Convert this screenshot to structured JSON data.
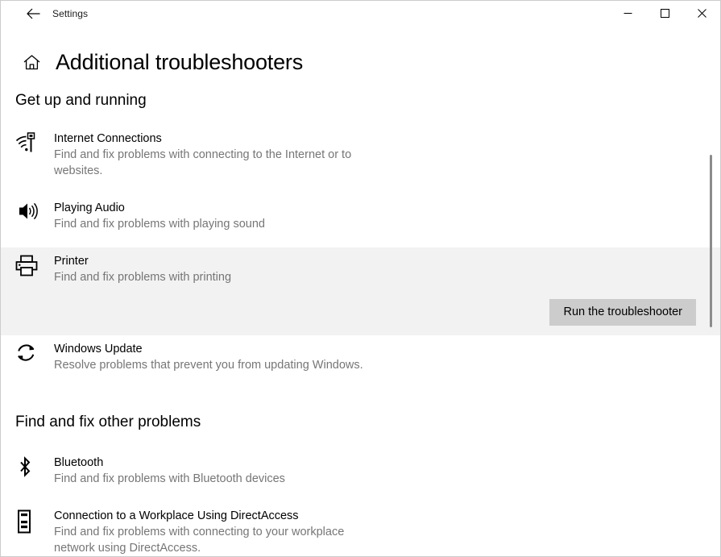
{
  "window": {
    "app_title": "Settings",
    "back_icon": "back-arrow-icon",
    "minimize_label": "─",
    "maximize_label": "□",
    "close_label": "✕"
  },
  "page": {
    "home_icon": "home-icon",
    "title": "Additional troubleshooters"
  },
  "sections": [
    {
      "title": "Get up and running",
      "items": [
        {
          "icon": "wifi-network-icon",
          "name": "Internet Connections",
          "description": "Find and fix problems with connecting to the Internet or to websites.",
          "selected": false
        },
        {
          "icon": "speaker-audio-icon",
          "name": "Playing Audio",
          "description": "Find and fix problems with playing sound",
          "selected": false
        },
        {
          "icon": "printer-icon",
          "name": "Printer",
          "description": "Find and fix problems with printing",
          "selected": true,
          "action_label": "Run the troubleshooter"
        },
        {
          "icon": "update-refresh-icon",
          "name": "Windows Update",
          "description": "Resolve problems that prevent you from updating Windows.",
          "selected": false
        }
      ]
    },
    {
      "title": "Find and fix other problems",
      "items": [
        {
          "icon": "bluetooth-icon",
          "name": "Bluetooth",
          "description": "Find and fix problems with Bluetooth devices",
          "selected": false
        },
        {
          "icon": "workplace-device-icon",
          "name": "Connection to a Workplace Using DirectAccess",
          "description": "Find and fix problems with connecting to your workplace network using DirectAccess.",
          "selected": false
        }
      ]
    }
  ],
  "colors": {
    "selection_background": "#f2f2f2",
    "button_background": "#cccccc",
    "description_text": "#767676",
    "scrollbar_thumb": "#8c8c8c"
  }
}
